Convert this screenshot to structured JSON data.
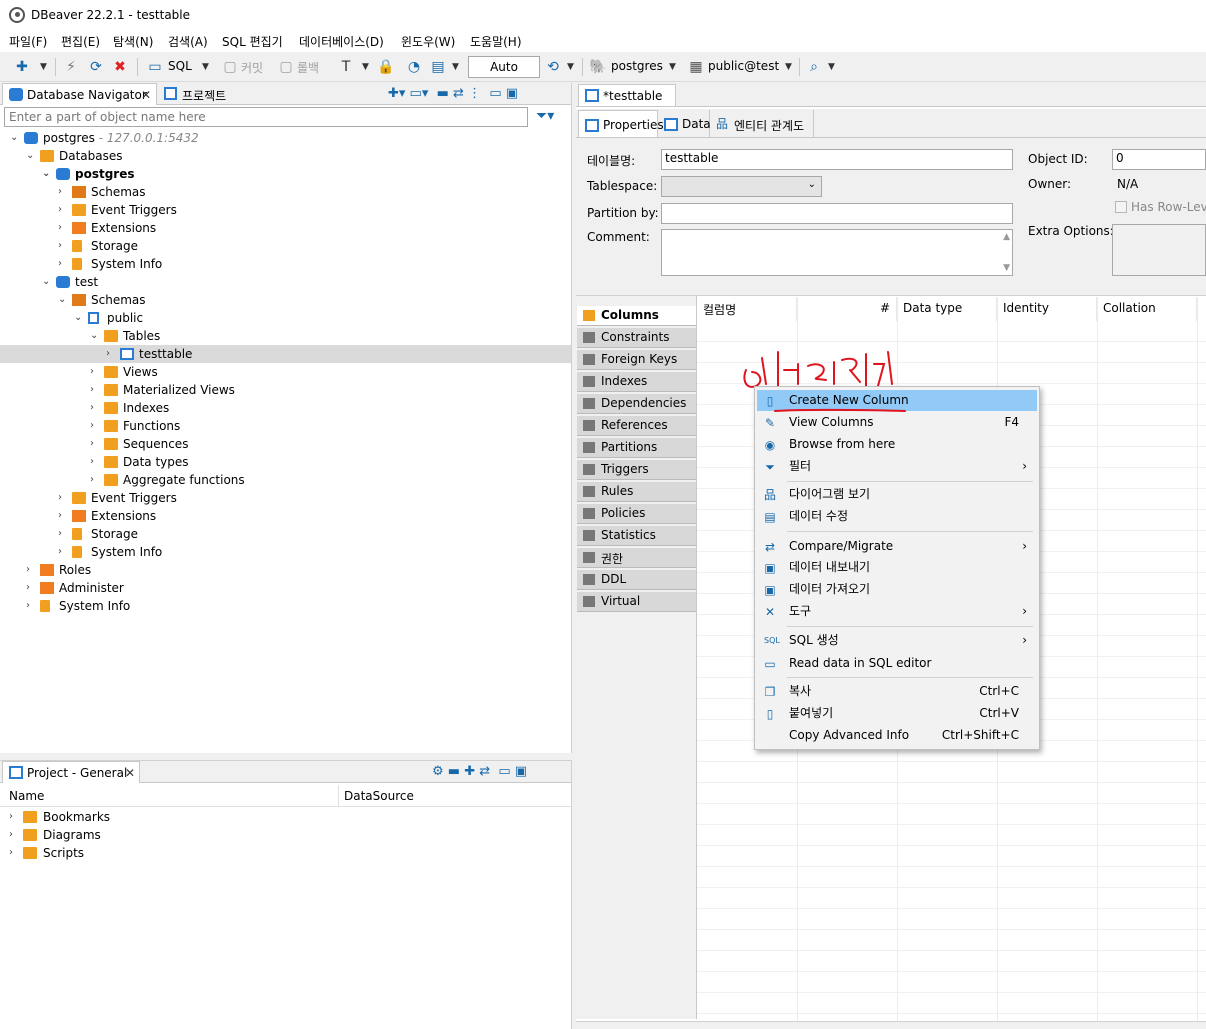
{
  "window": {
    "title": "DBeaver 22.2.1 - testtable"
  },
  "menu": [
    "파일(F)",
    "편집(E)",
    "탐색(N)",
    "검색(A)",
    "SQL 편집기",
    "데이터베이스(D)",
    "윈도우(W)",
    "도움말(H)"
  ],
  "toolbar": {
    "sql_label": "SQL",
    "commit_label": "커밋",
    "rollback_label": "롤백",
    "transaction_mode": "Auto",
    "datasource": "postgres",
    "schema": "public@test"
  },
  "navigator": {
    "tab_label": "Database Navigator",
    "project_tab_label": "프로젝트",
    "filter_placeholder": "Enter a part of object name here",
    "tree": [
      {
        "label": "postgres",
        "suffix": " - 127.0.0.1:5432"
      },
      {
        "label": "Databases"
      },
      {
        "label": "postgres"
      },
      {
        "label": "Schemas"
      },
      {
        "label": "Event Triggers"
      },
      {
        "label": "Extensions"
      },
      {
        "label": "Storage"
      },
      {
        "label": "System Info"
      },
      {
        "label": "test"
      },
      {
        "label": "Schemas"
      },
      {
        "label": "public"
      },
      {
        "label": "Tables"
      },
      {
        "label": "testtable"
      },
      {
        "label": "Views"
      },
      {
        "label": "Materialized Views"
      },
      {
        "label": "Indexes"
      },
      {
        "label": "Functions"
      },
      {
        "label": "Sequences"
      },
      {
        "label": "Data types"
      },
      {
        "label": "Aggregate functions"
      },
      {
        "label": "Event Triggers"
      },
      {
        "label": "Extensions"
      },
      {
        "label": "Storage"
      },
      {
        "label": "System Info"
      },
      {
        "label": "Roles"
      },
      {
        "label": "Administer"
      },
      {
        "label": "System Info"
      }
    ]
  },
  "project": {
    "tab_label": "Project - General",
    "col_name": "Name",
    "col_datasource": "DataSource",
    "items": [
      "Bookmarks",
      "Diagrams",
      "Scripts"
    ]
  },
  "editor": {
    "tab_label": "*testtable",
    "subtabs": [
      "Properties",
      "Data",
      "엔티티 관계도"
    ],
    "table_name_label": "테이블명:",
    "table_name_value": "testtable",
    "tablespace_label": "Tablespace:",
    "partition_label": "Partition by:",
    "comment_label": "Comment:",
    "object_id_label": "Object ID:",
    "object_id_value": "0",
    "owner_label": "Owner:",
    "owner_value": "N/A",
    "row_level_label": "Has Row-Leve",
    "extra_options_label": "Extra Options:",
    "side_tabs": [
      "Columns",
      "Constraints",
      "Foreign Keys",
      "Indexes",
      "Dependencies",
      "References",
      "Partitions",
      "Triggers",
      "Rules",
      "Policies",
      "Statistics",
      "권한",
      "DDL",
      "Virtual"
    ],
    "columns_header": [
      "컬럼명",
      "#",
      "Data type",
      "Identity",
      "Collation"
    ]
  },
  "context_menu": {
    "items": [
      {
        "label": "Create New Column",
        "shortcut": "",
        "icon": "column-icon"
      },
      {
        "label": "View Columns",
        "shortcut": "F4",
        "icon": "pencil-icon"
      },
      {
        "label": "Browse from here",
        "shortcut": "",
        "icon": "database-icon"
      },
      {
        "label": "필터",
        "shortcut": "",
        "icon": "filter-icon"
      },
      {
        "label": "다이어그램 보기",
        "shortcut": "",
        "icon": "diagram-icon"
      },
      {
        "label": "데이터 수정",
        "shortcut": "",
        "icon": "edit-data-icon"
      },
      {
        "label": "Compare/Migrate",
        "shortcut": "",
        "icon": "compare-icon"
      },
      {
        "label": "데이터 내보내기",
        "shortcut": "",
        "icon": "export-icon"
      },
      {
        "label": "데이터 가져오기",
        "shortcut": "",
        "icon": "import-icon"
      },
      {
        "label": "도구",
        "shortcut": "",
        "icon": "tools-icon"
      },
      {
        "label": "SQL 생성",
        "shortcut": "",
        "icon": "sql-icon"
      },
      {
        "label": "Read data in SQL editor",
        "shortcut": "",
        "icon": "sql-editor-icon"
      },
      {
        "label": "복사",
        "shortcut": "Ctrl+C",
        "icon": "copy-icon"
      },
      {
        "label": "붙여넣기",
        "shortcut": "Ctrl+V",
        "icon": "paste-icon"
      },
      {
        "label": "Copy Advanced Info",
        "shortcut": "Ctrl+Shift+C",
        "icon": ""
      }
    ]
  },
  "colors": {
    "selection": "#91c9f7",
    "accent": "#1769aa",
    "folder": "#f0a01e",
    "annotation": "#e0141e"
  }
}
